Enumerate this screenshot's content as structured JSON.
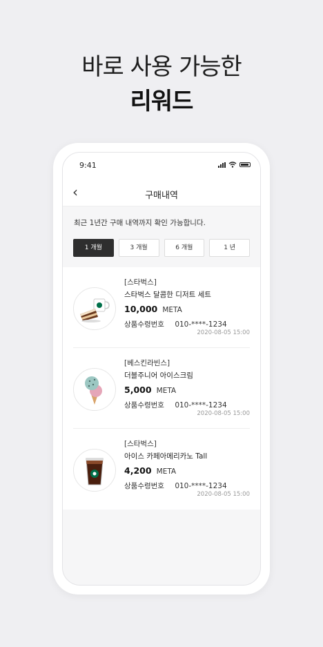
{
  "headline": {
    "line1": "바로 사용 가능한",
    "line2": "리워드"
  },
  "status": {
    "time": "9:41"
  },
  "nav": {
    "back": "‹",
    "title": "구매내역"
  },
  "notice": "최근 1년간 구매 내역까지 확인 가능합니다.",
  "filters": [
    {
      "label": "1 개월",
      "active": true
    },
    {
      "label": "3 개월",
      "active": false
    },
    {
      "label": "6 개월",
      "active": false
    },
    {
      "label": "1 년",
      "active": false
    }
  ],
  "items": [
    {
      "brand": "[스타벅스]",
      "name": "스타벅스 달콤한 디저트 세트",
      "price": "10,000",
      "unit": "META",
      "code_label": "상품수령번호",
      "code": "010-****-1234",
      "date": "2020-08-05 15:00",
      "image": "cake-coffee-icon"
    },
    {
      "brand": "[베스킨라빈스]",
      "name": "더블주니어 아이스크림",
      "price": "5,000",
      "unit": "META",
      "code_label": "상품수령번호",
      "code": "010-****-1234",
      "date": "2020-08-05 15:00",
      "image": "ice-cream-icon"
    },
    {
      "brand": "[스타벅스]",
      "name": "아이스 카페아메리카노 Tall",
      "price": "4,200",
      "unit": "META",
      "code_label": "상품수령번호",
      "code": "010-****-1234",
      "date": "2020-08-05 15:00",
      "image": "iced-coffee-icon"
    }
  ],
  "colors": {
    "accent": "#2e2e2e",
    "background": "#efeff2"
  }
}
